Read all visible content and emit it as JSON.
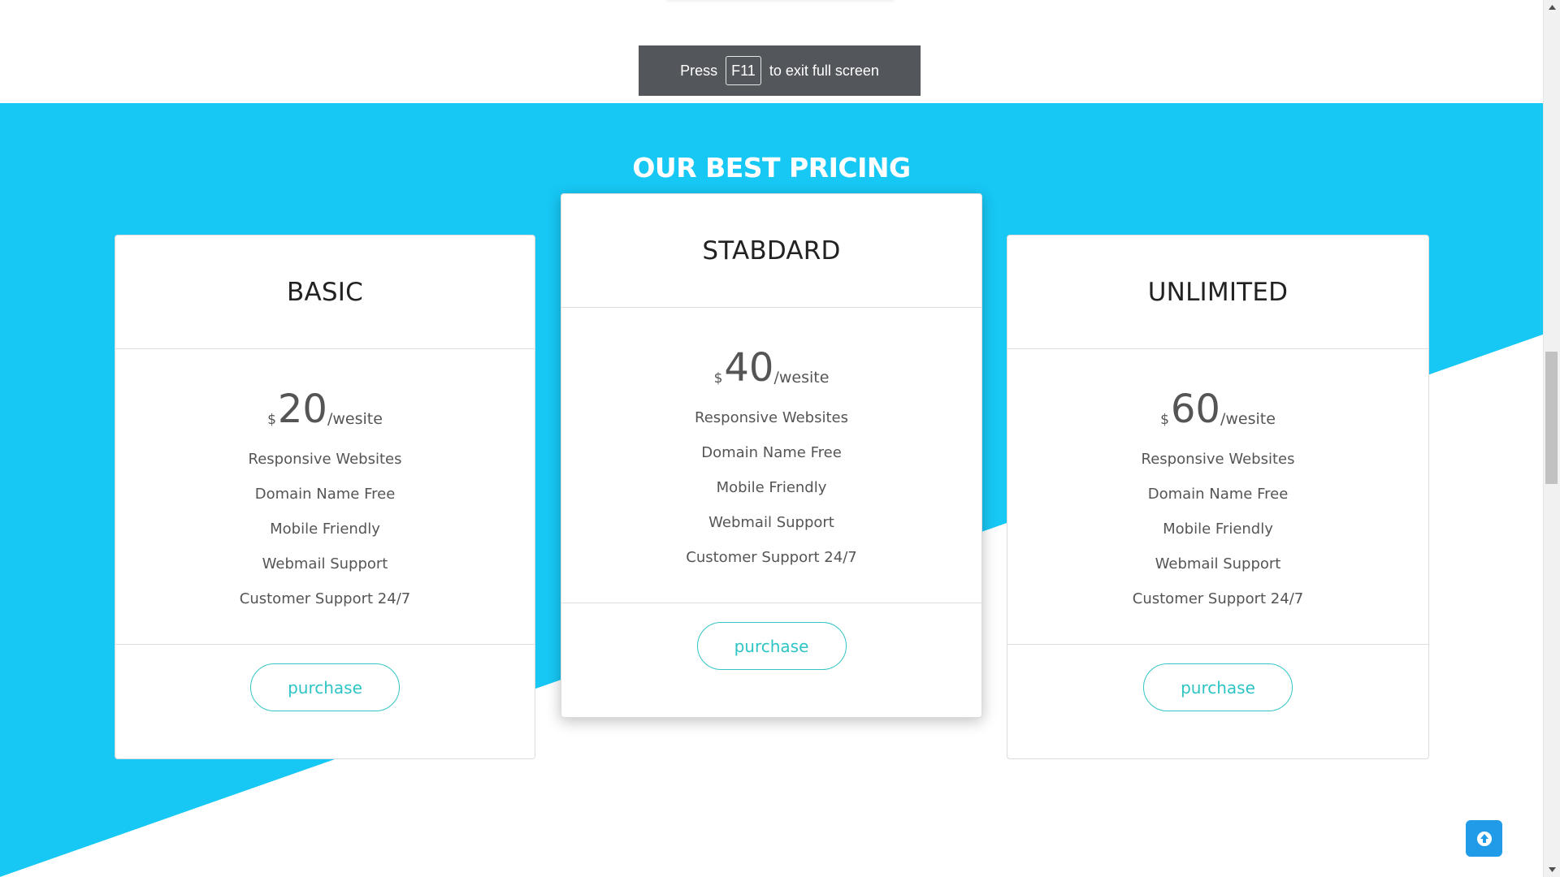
{
  "fullscreen_toast": {
    "prefix": "Press",
    "key": "F11",
    "suffix": "to exit full screen"
  },
  "pricing": {
    "title": "OUR BEST PRICING",
    "plans": [
      {
        "name": "BASIC",
        "currency": "$",
        "amount": "20",
        "per": "/wesite",
        "features": [
          "Responsive Websites",
          "Domain Name Free",
          "Mobile Friendly",
          "Webmail Support",
          "Customer Support 24/7"
        ],
        "button": "purchase"
      },
      {
        "name": "STABDARD",
        "currency": "$",
        "amount": "40",
        "per": "/wesite",
        "features": [
          "Responsive Websites",
          "Domain Name Free",
          "Mobile Friendly",
          "Webmail Support",
          "Customer Support 24/7"
        ],
        "button": "purchase"
      },
      {
        "name": "UNLIMITED",
        "currency": "$",
        "amount": "60",
        "per": "/wesite",
        "features": [
          "Responsive Websites",
          "Domain Name Free",
          "Mobile Friendly",
          "Webmail Support",
          "Customer Support 24/7"
        ],
        "button": "purchase"
      }
    ]
  },
  "icons": {
    "scroll_top": "arrow-up-icon",
    "scroll_up": "triangle-up-icon",
    "scroll_down": "triangle-down-icon"
  },
  "colors": {
    "section_bg": "#17c8f5",
    "accent": "#2ec4c4",
    "toast_bg": "#53565a",
    "scroll_top_bg": "#1f9be8"
  }
}
